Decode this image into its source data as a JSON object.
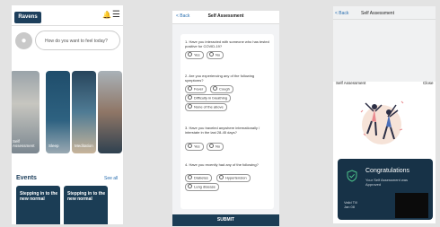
{
  "screen1": {
    "logo": "Ravens",
    "search_placeholder": "How do you want to feel today?",
    "tiles": [
      "Self Assessment",
      "Sleep",
      "Meditation",
      ""
    ],
    "section_title": "Events",
    "see_all": "See all",
    "cards": [
      "Stepping in to the new normal",
      "Stepping in to the new normal"
    ]
  },
  "screen2": {
    "back": "< Back",
    "title": "Self Assessment",
    "questions": [
      {
        "text": "1. Have you interacted with someone who has tested positive for COVID-19?",
        "options": [
          "Yes",
          "No"
        ]
      },
      {
        "text": "2. Are you experiencing any of the following symptoms?",
        "options": [
          "Fever",
          "Cough",
          "Difficulty in breathing",
          "None of the above"
        ]
      },
      {
        "text": "3. Have you traveled anywhere internationally / interstate in the last 28-45 days?",
        "options": [
          "Yes",
          "No"
        ]
      },
      {
        "text": "4. Have you recently had any of the following?",
        "options": [
          "Diabetes",
          "Hypertension",
          "Lung disease"
        ]
      }
    ],
    "submit": "SUBMIT"
  },
  "screen3": {
    "back": "< Back",
    "title": "Self Assessment",
    "label": "Self Assessment",
    "close": "Close",
    "result_title": "Congratulations",
    "result_desc": "Your Self Assessment was Approved",
    "valid_label": "Valid Till",
    "valid_date": "Jan 08",
    "accent": "#173247"
  }
}
